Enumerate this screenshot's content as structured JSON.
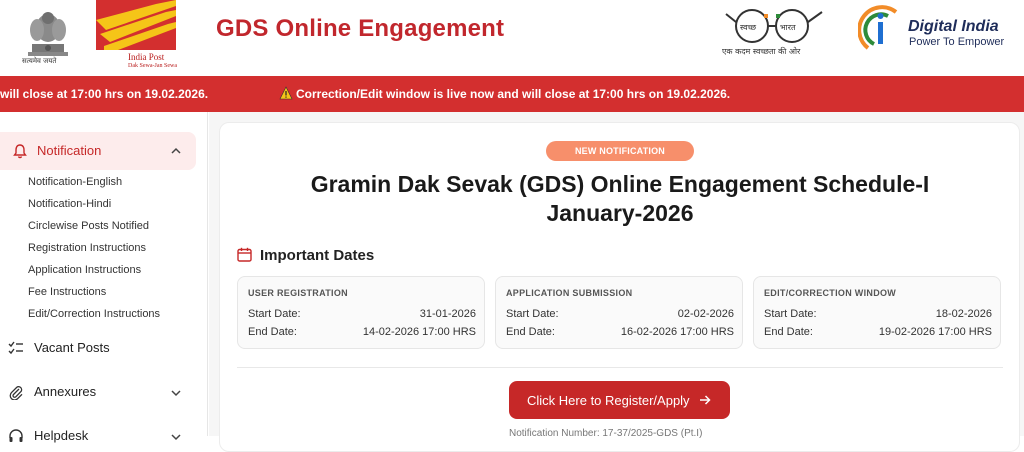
{
  "header": {
    "emblem_motto": "सत्यमेव जयते",
    "indiapost_name": "India Post",
    "indiapost_tagline": "Dak Sewa-Jan Sewa",
    "site_title": "GDS Online Engagement",
    "swachh_label_left": "स्वच्छ",
    "swachh_label_right": "भारत",
    "swachh_tagline": "एक कदम स्वच्छता की ओर",
    "digital_india_title": "Digital India",
    "digital_india_sub": "Power To Empower"
  },
  "ticker": {
    "text_1": "will close at 17:00 hrs on 19.02.2026.",
    "text_2": "Correction/Edit window is live now and will close at 17:00 hrs on 19.02.2026."
  },
  "sidebar": {
    "active_label": "Notification",
    "sub_items": [
      "Notification-English",
      "Notification-Hindi",
      "Circlewise Posts Notified",
      "Registration Instructions",
      "Application Instructions",
      "Fee Instructions",
      "Edit/Correction Instructions"
    ],
    "items": [
      {
        "label": "Vacant Posts"
      },
      {
        "label": "Annexures"
      },
      {
        "label": "Helpdesk"
      }
    ]
  },
  "main": {
    "badge": "NEW NOTIFICATION",
    "title_line_1": "Gramin Dak Sevak (GDS) Online Engagement Schedule-I",
    "title_line_2": "January-2026",
    "important_dates_title": "Important Dates",
    "date_cards": [
      {
        "heading": "USER REGISTRATION",
        "start_label": "Start Date:",
        "start_value": "31-01-2026",
        "end_label": "End Date:",
        "end_value": "14-02-2026 17:00 HRS"
      },
      {
        "heading": "APPLICATION SUBMISSION",
        "start_label": "Start Date:",
        "start_value": "02-02-2026",
        "end_label": "End Date:",
        "end_value": "16-02-2026 17:00 HRS"
      },
      {
        "heading": "EDIT/CORRECTION WINDOW",
        "start_label": "Start Date:",
        "start_value": "18-02-2026",
        "end_label": "End Date:",
        "end_value": "19-02-2026 17:00 HRS"
      }
    ],
    "apply_button": "Click Here to Register/Apply",
    "notification_number": "Notification Number: 17-37/2025-GDS (Pt.I)"
  },
  "colors": {
    "brand_red": "#c62828",
    "ticker_red": "#d32f2f",
    "badge_orange": "#f78f6b",
    "digital_india_navy": "#1f2d5a"
  }
}
